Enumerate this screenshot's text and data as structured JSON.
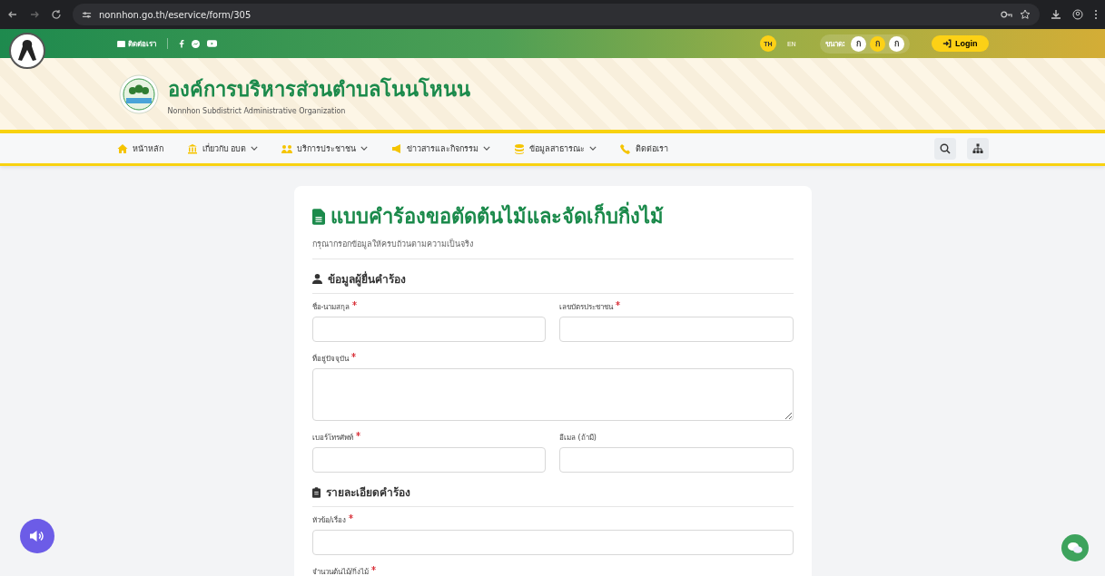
{
  "browser": {
    "url": "nonnhon.go.th/eservice/form/305"
  },
  "topbar": {
    "contact": "ติดต่อเรา",
    "languages": [
      {
        "label": "TH",
        "selected": true
      },
      {
        "label": "EN",
        "selected": false
      }
    ],
    "size_label": "ขนาด:",
    "sizes": [
      {
        "label": "ก",
        "selected": false
      },
      {
        "label": "ก",
        "selected": true
      },
      {
        "label": "ก",
        "selected": false
      }
    ],
    "login": "Login"
  },
  "header": {
    "title": "องค์การบริหารส่วนตำบลโนนโหนน",
    "subtitle": "Nonnhon Subdistrict Administrative Organization"
  },
  "nav": [
    {
      "label": "หน้าหลัก",
      "dropdown": false
    },
    {
      "label": "เกี่ยวกับ อบต",
      "dropdown": true
    },
    {
      "label": "บริการประชาชน",
      "dropdown": true
    },
    {
      "label": "ข่าวสารและกิจกรรม",
      "dropdown": true
    },
    {
      "label": "ข้อมูลสาธารณะ",
      "dropdown": true
    },
    {
      "label": "ติดต่อเรา",
      "dropdown": false
    }
  ],
  "form": {
    "title": "แบบคำร้องขอตัดต้นไม้และจัดเก็บกิ่งไม้",
    "subtitle": "กรุณากรอกข้อมูลให้ครบถ้วนตามความเป็นจริง",
    "sections": [
      {
        "title": "ข้อมูลผู้ยื่นคำร้อง",
        "fields": [
          {
            "label": "ชื่อ-นามสกุล",
            "required": true,
            "kind": "half"
          },
          {
            "label": "เลขบัตรประชาชน",
            "required": true,
            "kind": "half"
          },
          {
            "label": "ที่อยู่ปัจจุบัน",
            "required": true,
            "kind": "area"
          },
          {
            "label": "เบอร์โทรศัพท์",
            "required": true,
            "kind": "half"
          },
          {
            "label": "อีเมล (ถ้ามี)",
            "required": false,
            "kind": "half"
          }
        ]
      },
      {
        "title": "รายละเอียดคำร้อง",
        "fields": [
          {
            "label": "หัวข้อ/เรื่อง",
            "required": true,
            "kind": "full"
          },
          {
            "label": "จำนวนต้นไม้/กิ่งไม้",
            "required": true,
            "kind": "label"
          }
        ]
      }
    ]
  }
}
